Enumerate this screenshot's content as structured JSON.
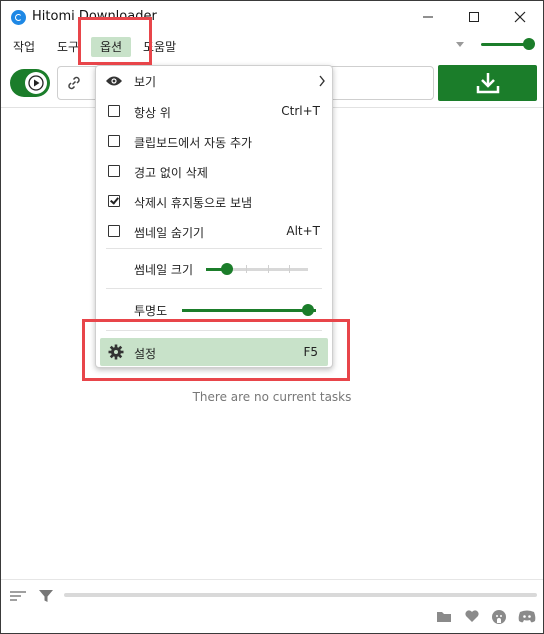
{
  "window": {
    "title": "Hitomi Downloader"
  },
  "menubar": {
    "items": [
      "작업",
      "도구",
      "옵션",
      "도움말"
    ],
    "active": "옵션"
  },
  "main": {
    "empty_message": "There are no current tasks"
  },
  "options_menu": {
    "view": "보기",
    "always_on_top": {
      "label": "항상 위",
      "shortcut": "Ctrl+T",
      "checked": false
    },
    "clipboard_auto_add": {
      "label": "클립보드에서 자동 추가",
      "checked": false
    },
    "delete_without_warning": {
      "label": "경고 없이 삭제",
      "checked": false
    },
    "send_to_trash": {
      "label": "삭제시 휴지통으로 보냄",
      "checked": true
    },
    "hide_thumbnail": {
      "label": "썸네일 숨기기",
      "shortcut": "Alt+T",
      "checked": false
    },
    "thumbnail_size": {
      "label": "썸네일 크기",
      "level": 0.15
    },
    "transparency": {
      "label": "투명도",
      "level": 1.0
    },
    "settings": {
      "label": "설정",
      "shortcut": "F5"
    }
  },
  "colors": {
    "accent": "#1b7d2a",
    "highlight": "#c8e2c9",
    "annotation": "#e8454a"
  }
}
